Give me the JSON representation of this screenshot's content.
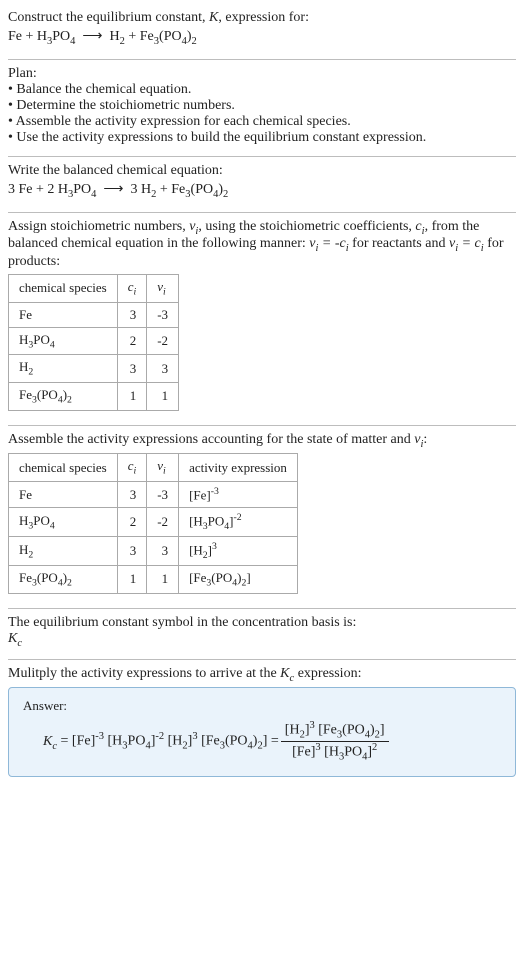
{
  "prompt": {
    "line1_a": "Construct the equilibrium constant, ",
    "line1_b": ", expression for:",
    "eq_lhs_a": "Fe + H",
    "eq_lhs_b": "PO",
    "arrow": "⟶",
    "eq_rhs_a": "H",
    "eq_rhs_b": " + Fe",
    "eq_rhs_c": "(PO",
    "eq_rhs_d": ")"
  },
  "plan": {
    "title": "Plan:",
    "b1": "• Balance the chemical equation.",
    "b2": "• Determine the stoichiometric numbers.",
    "b3": "• Assemble the activity expression for each chemical species.",
    "b4": "• Use the activity expressions to build the equilibrium constant expression."
  },
  "balanced": {
    "title": "Write the balanced chemical equation:",
    "lhs_a": "3 Fe + 2 H",
    "lhs_b": "PO",
    "arrow": "⟶",
    "rhs_a": "3 H",
    "rhs_b": " + Fe",
    "rhs_c": "(PO",
    "rhs_d": ")"
  },
  "assign": {
    "p1": "Assign stoichiometric numbers, ",
    "p2": ", using the stoichiometric coefficients, ",
    "p3": ", from the balanced chemical equation in the following manner: ",
    "p4": " for reactants and ",
    "p5": " for products:"
  },
  "table1": {
    "h1": "chemical species",
    "rows": [
      {
        "sp": "Fe",
        "c": "3",
        "v": "-3"
      },
      {
        "sp": "H3PO4",
        "c": "2",
        "v": "-2"
      },
      {
        "sp": "H2",
        "c": "3",
        "v": "3"
      },
      {
        "sp": "Fe3(PO4)2",
        "c": "1",
        "v": "1"
      }
    ]
  },
  "assembleLine": {
    "a": "Assemble the activity expressions accounting for the state of matter and ",
    "b": ":"
  },
  "table2": {
    "h1": "chemical species",
    "h4": "activity expression"
  },
  "eqconst": {
    "line1": "The equilibrium constant symbol in the concentration basis is:"
  },
  "multiply": {
    "line_a": "Mulitply the activity expressions to arrive at the ",
    "line_b": " expression:"
  },
  "answer": {
    "label": "Answer:"
  }
}
